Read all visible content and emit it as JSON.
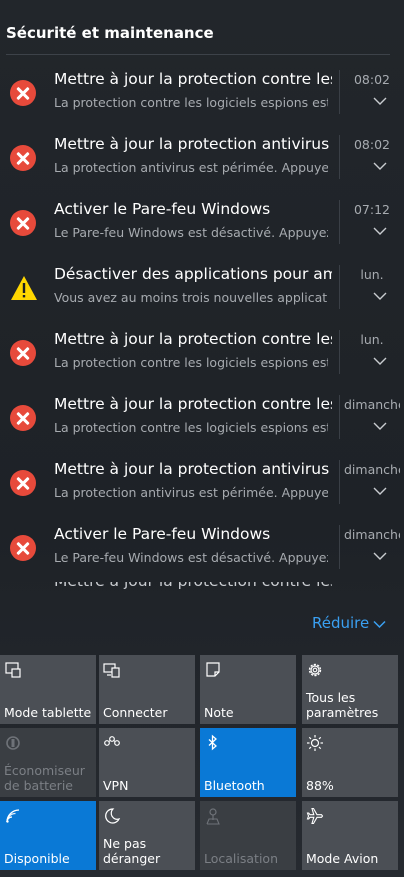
{
  "header": {
    "title": "Sécurité et maintenance"
  },
  "notifications": [
    {
      "icon": "error-icon",
      "title": "Mettre à jour la protection contre les logiciels espions",
      "desc": "La protection contre les logiciels espions est périmée.",
      "time": "08:02"
    },
    {
      "icon": "error-icon",
      "title": "Mettre à jour la protection antivirus",
      "desc": "La protection antivirus est périmée. Appuyez ou cliquez ici",
      "time": "08:02"
    },
    {
      "icon": "error-icon",
      "title": "Activer le Pare-feu Windows",
      "desc": "Le Pare-feu Windows est désactivé. Appuyez ou cliquez ici",
      "time": "07:12"
    },
    {
      "icon": "warning-icon",
      "title": "Désactiver des applications pour améliorer les performances",
      "desc": "Vous avez au moins trois nouvelles applications",
      "time": "lun."
    },
    {
      "icon": "error-icon",
      "title": "Mettre à jour la protection contre les logiciels espions",
      "desc": "La protection contre les logiciels espions est périmée.",
      "time": "lun."
    },
    {
      "icon": "error-icon",
      "title": "Mettre à jour la protection contre les logiciels espions",
      "desc": "La protection contre les logiciels espions est périmée.",
      "time": "dimanche"
    },
    {
      "icon": "error-icon",
      "title": "Mettre à jour la protection antivirus",
      "desc": "La protection antivirus est périmée. Appuyez ou cliquez ici",
      "time": "dimanche"
    },
    {
      "icon": "error-icon",
      "title": "Activer le Pare-feu Windows",
      "desc": "Le Pare-feu Windows est désactivé. Appuyez ou cliquez ici",
      "time": "dimanche"
    }
  ],
  "partial_item": {
    "title": "Mettre à jour la protection contre les"
  },
  "reduce_label": "Réduire",
  "quick_actions": [
    {
      "label": "Mode tablette",
      "icon": "tablet-mode-icon",
      "state": "normal"
    },
    {
      "label": "Connecter",
      "icon": "connect-icon",
      "state": "normal"
    },
    {
      "label": "Note",
      "icon": "note-icon",
      "state": "normal"
    },
    {
      "label": "Tous les paramètres",
      "icon": "gear-icon",
      "state": "normal"
    },
    {
      "label": "Économiseur de batterie",
      "icon": "battery-saver-icon",
      "state": "disabled"
    },
    {
      "label": "VPN",
      "icon": "vpn-icon",
      "state": "normal"
    },
    {
      "label": "Bluetooth",
      "icon": "bluetooth-icon",
      "state": "active"
    },
    {
      "label": "88%",
      "icon": "brightness-icon",
      "state": "normal"
    },
    {
      "label": "Disponible",
      "icon": "wifi-icon",
      "state": "active"
    },
    {
      "label": "Ne pas déranger",
      "icon": "moon-icon",
      "state": "normal"
    },
    {
      "label": "Localisation",
      "icon": "location-icon",
      "state": "disabled"
    },
    {
      "label": "Mode Avion",
      "icon": "airplane-icon",
      "state": "normal"
    }
  ],
  "colors": {
    "accent": "#0a79d6",
    "error": "#e74a3b",
    "warning": "#ffd700",
    "link": "#3aa0f2"
  }
}
